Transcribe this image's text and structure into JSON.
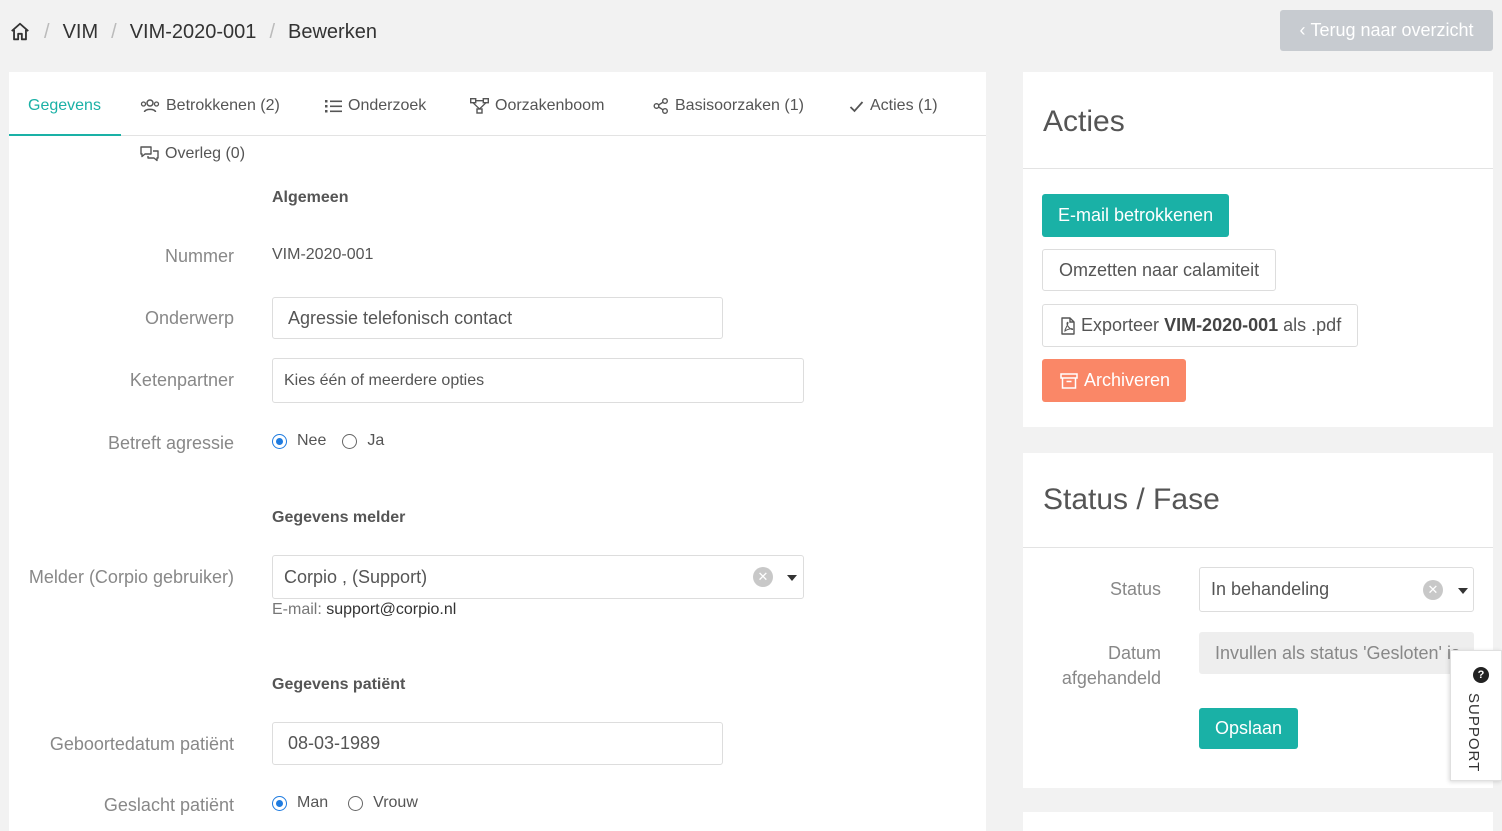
{
  "breadcrumb": {
    "items": [
      "VIM",
      "VIM-2020-001",
      "Bewerken"
    ],
    "separator": "/"
  },
  "back_button": {
    "label": "Terug naar overzicht"
  },
  "tabs": [
    {
      "label": "Gegevens",
      "icon": "none",
      "active": true
    },
    {
      "label": "Betrokkenen (2)",
      "icon": "users-icon"
    },
    {
      "label": "Onderzoek",
      "icon": "list-icon"
    },
    {
      "label": "Oorzakenboom",
      "icon": "tree-icon"
    },
    {
      "label": "Basisoorzaken (1)",
      "icon": "share-icon"
    },
    {
      "label": "Acties (1)",
      "icon": "check-icon"
    },
    {
      "label": "Overleg (0)",
      "icon": "comments-icon"
    }
  ],
  "form": {
    "section_general": "Algemeen",
    "nummer_label": "Nummer",
    "nummer_value": "VIM-2020-001",
    "onderwerp_label": "Onderwerp",
    "onderwerp_value": "Agressie telefonisch contact",
    "ketenpartner_label": "Ketenpartner",
    "ketenpartner_placeholder": "Kies één of meerdere opties",
    "agressie_label": "Betreft agressie",
    "agressie_options": [
      "Nee",
      "Ja"
    ],
    "agressie_selected": "Nee",
    "section_melder": "Gegevens melder",
    "melder_label": "Melder (Corpio gebruiker)",
    "melder_value": "Corpio , (Support)",
    "email_label": "E-mail:",
    "email_value": "support@corpio.nl",
    "section_patient": "Gegevens patiënt",
    "geboortedatum_label": "Geboortedatum patiënt",
    "geboortedatum_value": "08-03-1989",
    "geslacht_label": "Geslacht patiënt",
    "geslacht_options": [
      "Man",
      "Vrouw"
    ],
    "geslacht_selected": "Man"
  },
  "acties_card": {
    "title": "Acties",
    "email_button": "E-mail betrokkenen",
    "omzetten_button": "Omzetten naar calamiteit",
    "export_prefix": "Exporteer",
    "export_bold": "VIM-2020-001",
    "export_suffix": "als .pdf",
    "archive_button": "Archiveren"
  },
  "status_card": {
    "title": "Status / Fase",
    "status_label": "Status",
    "status_value": "In behandeling",
    "datum_label_line1": "Datum",
    "datum_label_line2": "afgehandeld",
    "datum_placeholder": "Invullen als status 'Gesloten' is",
    "save_button": "Opslaan"
  },
  "support_tab": {
    "label": "SUPPORT"
  },
  "colors": {
    "accent": "#1ab1a6",
    "danger": "#fa8767",
    "back_button_bg": "#c7cbd0",
    "radio_selected": "#1e7be0"
  }
}
